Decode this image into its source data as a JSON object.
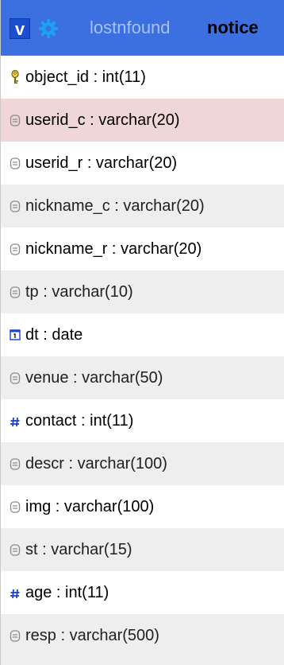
{
  "header": {
    "v_label": "v",
    "db_name": "lostnfound",
    "table_name": "notice"
  },
  "fields": [
    {
      "label": "object_id : int(11)",
      "icon": "key-icon",
      "bg": "white"
    },
    {
      "label": "userid_c : varchar(20)",
      "icon": "text-field-icon",
      "bg": "pink"
    },
    {
      "label": "userid_r : varchar(20)",
      "icon": "text-field-icon",
      "bg": "white"
    },
    {
      "label": "nickname_c : varchar(20)",
      "icon": "text-field-icon",
      "bg": "grey"
    },
    {
      "label": "nickname_r : varchar(20)",
      "icon": "text-field-icon",
      "bg": "white"
    },
    {
      "label": "tp : varchar(10)",
      "icon": "text-field-icon",
      "bg": "grey"
    },
    {
      "label": "dt : date",
      "icon": "calendar-icon",
      "bg": "white"
    },
    {
      "label": "venue : varchar(50)",
      "icon": "text-field-icon",
      "bg": "grey"
    },
    {
      "label": "contact : int(11)",
      "icon": "hash-icon",
      "bg": "white"
    },
    {
      "label": "descr : varchar(100)",
      "icon": "text-field-icon",
      "bg": "grey"
    },
    {
      "label": "img : varchar(100)",
      "icon": "text-field-icon",
      "bg": "white"
    },
    {
      "label": "st : varchar(15)",
      "icon": "text-field-icon",
      "bg": "grey"
    },
    {
      "label": "age : int(11)",
      "icon": "hash-icon",
      "bg": "white"
    },
    {
      "label": "resp : varchar(500)",
      "icon": "text-field-icon",
      "bg": "grey"
    }
  ],
  "colors": {
    "header_bg": "#3c6fe0",
    "db_name": "#a8c2f5",
    "row_white": "#ffffff",
    "row_grey": "#eeeeee",
    "row_highlight": "#f0d6d6",
    "hash_icon": "#1a3fd6"
  }
}
